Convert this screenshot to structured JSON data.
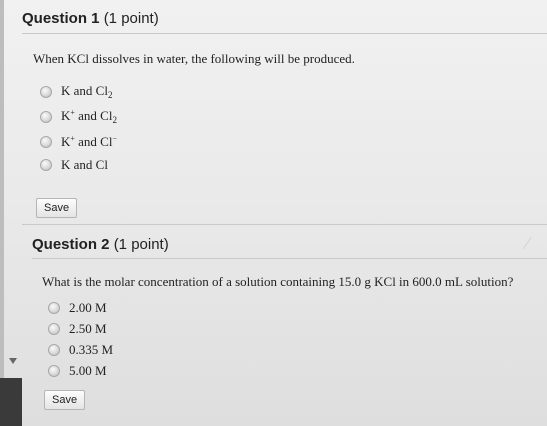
{
  "question1": {
    "label": "Question 1",
    "points": "(1 point)",
    "prompt": "When KCl dissolves in water, the following will be produced.",
    "options": [
      {
        "pre": "K and Cl",
        "sub": "2",
        "sup": "",
        "post": ""
      },
      {
        "pre": "K",
        "sup": "+",
        "mid": " and Cl",
        "sub": "2"
      },
      {
        "pre": "K",
        "sup": "+",
        "mid": " and Cl",
        "sup2": "−"
      },
      {
        "pre": "K and Cl"
      }
    ],
    "save_label": "Save"
  },
  "question2": {
    "label": "Question 2",
    "points": "(1 point)",
    "prompt": "What is the molar concentration of a solution containing 15.0 g KCl in 600.0 mL solution?",
    "options": [
      "2.00 M",
      "2.50 M",
      "0.335 M",
      "5.00 M"
    ],
    "save_label": "Save"
  }
}
